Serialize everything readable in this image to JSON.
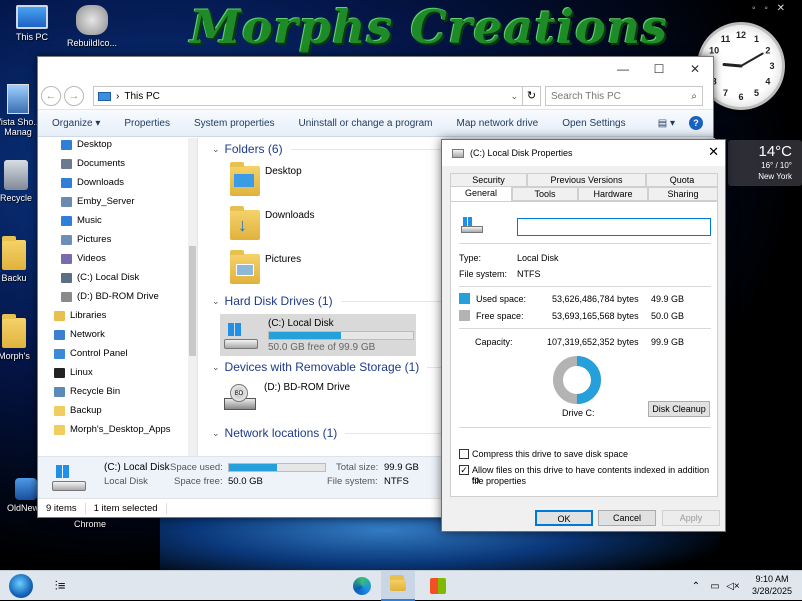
{
  "desktop": {
    "banner": "Morphs Creations",
    "icons": [
      {
        "label": "This PC"
      },
      {
        "label": "RebuildIco..."
      },
      {
        "label": "Vista Sho... Manag"
      },
      {
        "label": "Recycle"
      },
      {
        "label": "Backu"
      },
      {
        "label": "Morph's"
      },
      {
        "label": "OldNewE"
      },
      {
        "label": "Chrome"
      }
    ],
    "clock": {
      "numbers": [
        "12",
        "1",
        "2",
        "3",
        "4",
        "5",
        "6",
        "7",
        "8",
        "9",
        "10",
        "11"
      ],
      "hour": 9,
      "minute": 10
    },
    "weather": {
      "temp": "14°C",
      "range": "16° / 10°",
      "city": "New York"
    }
  },
  "explorer": {
    "address": "This PC",
    "search_placeholder": "Search This PC",
    "toolbar": [
      "Organize ▾",
      "Properties",
      "System properties",
      "Uninstall or change a program",
      "Map network drive",
      "Open Settings"
    ],
    "nav": [
      {
        "label": "Desktop",
        "color": "#2f7fd8"
      },
      {
        "label": "Documents",
        "color": "#6b7a90"
      },
      {
        "label": "Downloads",
        "color": "#2f7fd8"
      },
      {
        "label": "Emby_Server",
        "color": "#6a8bb0"
      },
      {
        "label": "Music",
        "color": "#2f7fd8"
      },
      {
        "label": "Pictures",
        "color": "#6b8fb8"
      },
      {
        "label": "Videos",
        "color": "#7a6bb0"
      },
      {
        "label": "(C:) Local Disk",
        "color": "#5a6e84"
      },
      {
        "label": "(D:) BD-ROM Drive",
        "color": "#8a8a8a"
      },
      {
        "label": "Libraries",
        "color": "#e8c050"
      },
      {
        "label": "Network",
        "color": "#3a7fd0"
      },
      {
        "label": "Control Panel",
        "color": "#3a8ad8"
      },
      {
        "label": "Linux",
        "color": "#222222"
      },
      {
        "label": "Recycle Bin",
        "color": "#5a8ab8"
      },
      {
        "label": "Backup",
        "color": "#f2cd5d"
      },
      {
        "label": "Morph's_Desktop_Apps",
        "color": "#f2cd5d"
      }
    ],
    "groups": {
      "folders": "Folders (6)",
      "hdd": "Hard Disk Drives (1)",
      "removable": "Devices with Removable Storage (1)",
      "network": "Network locations (1)"
    },
    "folders": [
      "Desktop",
      "Downloads",
      "Pictures"
    ],
    "drive_c": {
      "name": "(C:) Local Disk",
      "free_text": "50.0 GB free of 99.9 GB",
      "used_fraction": 0.5
    },
    "drive_d": {
      "name": "(D:) BD-ROM Drive"
    },
    "details": {
      "name": "(C:) Local Disk",
      "type": "Local Disk",
      "space_used_label": "Space used:",
      "space_free_label": "Space free:",
      "space_free": "50.0 GB",
      "total_size_label": "Total size:",
      "total_size": "99.9 GB",
      "fs_label": "File system:",
      "fs": "NTFS",
      "used_fraction": 0.5
    },
    "status": {
      "items": "9 items",
      "selected": "1 item selected"
    }
  },
  "props": {
    "title": "(C:) Local Disk Properties",
    "tabs_top": [
      "Security",
      "Previous Versions",
      "Quota"
    ],
    "tabs_bottom": [
      "General",
      "Tools",
      "Hardware",
      "Sharing"
    ],
    "name_value": "",
    "type_label": "Type:",
    "type": "Local Disk",
    "fs_label": "File system:",
    "fs": "NTFS",
    "used_label": "Used space:",
    "used_bytes": "53,626,486,784 bytes",
    "used_gb": "49.9 GB",
    "free_label": "Free space:",
    "free_bytes": "53,693,165,568 bytes",
    "free_gb": "50.0 GB",
    "cap_label": "Capacity:",
    "cap_bytes": "107,319,652,352 bytes",
    "cap_gb": "99.9 GB",
    "used_fraction": 0.4997,
    "drive_label": "Drive C:",
    "cleanup": "Disk Cleanup",
    "compress": "Compress this drive to save disk space",
    "index_line1": "Allow files on this drive to have contents indexed in addition to",
    "index_line2": "file properties",
    "ok": "OK",
    "cancel": "Cancel",
    "apply": "Apply",
    "colors": {
      "used": "#26a0da",
      "free": "#b3b3b3"
    }
  },
  "taskbar": {
    "time": "9:10 AM",
    "date": "3/28/2025"
  }
}
